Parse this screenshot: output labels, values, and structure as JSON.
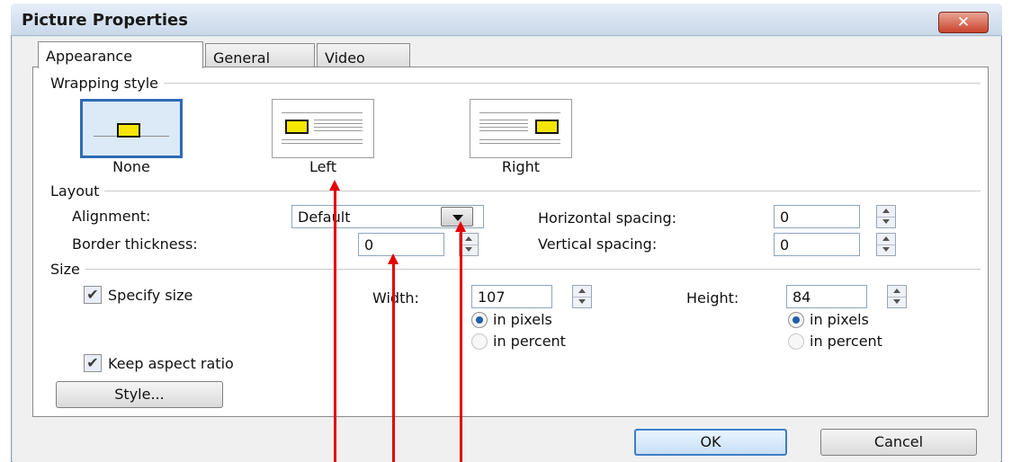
{
  "window": {
    "title": "Picture Properties",
    "close_glyph": "✕"
  },
  "tabs": [
    {
      "label": "Appearance",
      "active": true
    },
    {
      "label": "General",
      "active": false
    },
    {
      "label": "Video",
      "active": false
    }
  ],
  "wrapping": {
    "title": "Wrapping style",
    "options": [
      {
        "label": "None",
        "selected": true
      },
      {
        "label": "Left",
        "selected": false
      },
      {
        "label": "Right",
        "selected": false
      }
    ]
  },
  "layout": {
    "title": "Layout",
    "alignment_label": "Alignment:",
    "alignment_value": "Default",
    "border_label": "Border thickness:",
    "border_value": "0",
    "hspacing_label": "Horizontal spacing:",
    "hspacing_value": "0",
    "vspacing_label": "Vertical spacing:",
    "vspacing_value": "0"
  },
  "size": {
    "title": "Size",
    "specify_label": "Specify size",
    "specify_checked": true,
    "width_label": "Width:",
    "width_value": "107",
    "height_label": "Height:",
    "height_value": "84",
    "in_pixels": "in pixels",
    "in_percent": "in percent",
    "keep_aspect_label": "Keep aspect ratio",
    "keep_aspect_checked": true,
    "style_button": "Style..."
  },
  "buttons": {
    "ok": "OK",
    "cancel": "Cancel"
  },
  "colors": {
    "annotation_arrow": "#e60000",
    "selected_border": "#2e6bb5",
    "picture_fill": "#f5e600"
  }
}
